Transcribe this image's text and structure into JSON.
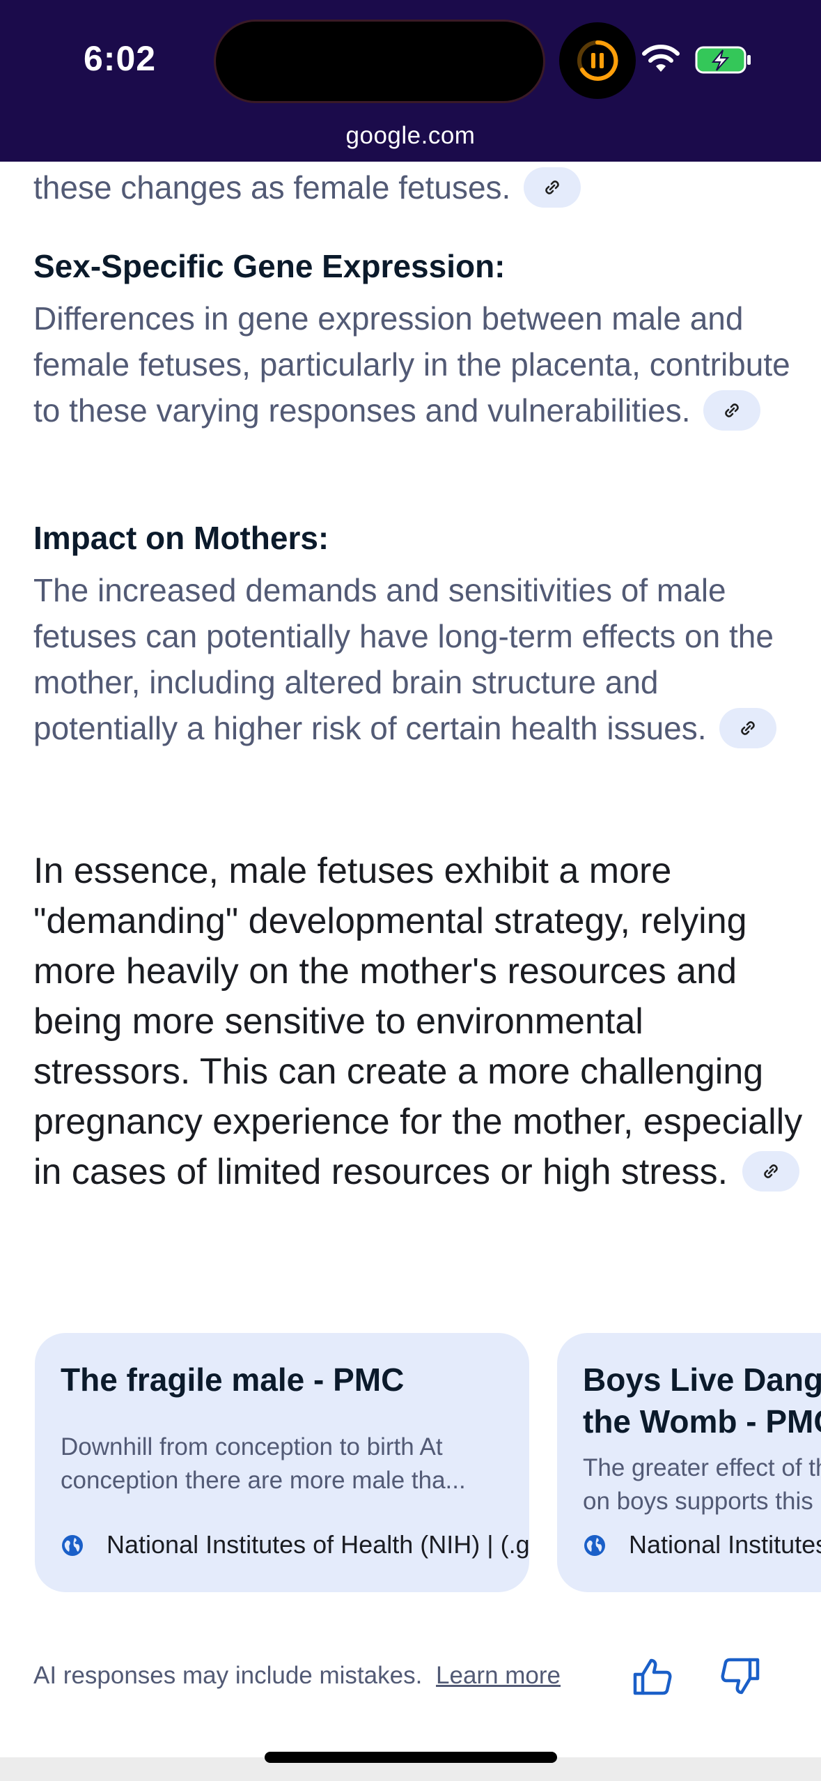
{
  "status_bar": {
    "time": "6:02",
    "url": "google.com"
  },
  "content": {
    "cut_line": "these changes as female fetuses.",
    "sections": [
      {
        "heading": "Sex-Specific Gene Expression:",
        "body": "Differences in gene expression between male and female fetuses, particularly in the placenta, contribute to these varying responses and vulnerabilities."
      },
      {
        "heading": "Impact on Mothers:",
        "body": "The increased demands and sensitivities of male fetuses can potentially have long-term effects on the mother, including altered brain structure and potentially a higher risk of certain health issues."
      }
    ],
    "essence": "In essence, male fetuses exhibit a more \"demanding\" developmental strategy, relying more heavily on the mother's resources and being more sensitive to environmental stressors. This can create a more challenging pregnancy experience for the mother, especially in cases of limited resources or high stress."
  },
  "cards": [
    {
      "title": "The fragile male - PMC",
      "snippet": "Downhill from conception to birth At conception there are more male tha...",
      "source": "National Institutes of Health (NIH) | (.gov)"
    },
    {
      "title": "Boys Live Dangerously in\nthe Womb - PMC",
      "snippet": "The greater effect of the\non boys supports this",
      "source": "National Institutes of Health"
    }
  ],
  "footer": {
    "disclaimer": "AI responses may include mistakes.",
    "learn_more": "Learn more"
  },
  "colors": {
    "header_bg": "#1b0b4b",
    "accent_blue": "#1a5fc8",
    "chip_bg": "#e4ebfb",
    "battery_green": "#34c759"
  },
  "icons": {
    "link": "link-icon",
    "globe": "globe-icon",
    "thumbs_up": "thumbs-up-icon",
    "thumbs_down": "thumbs-down-icon",
    "wifi": "wifi-icon",
    "battery": "battery-charging-icon",
    "timer": "pause-timer-icon"
  }
}
